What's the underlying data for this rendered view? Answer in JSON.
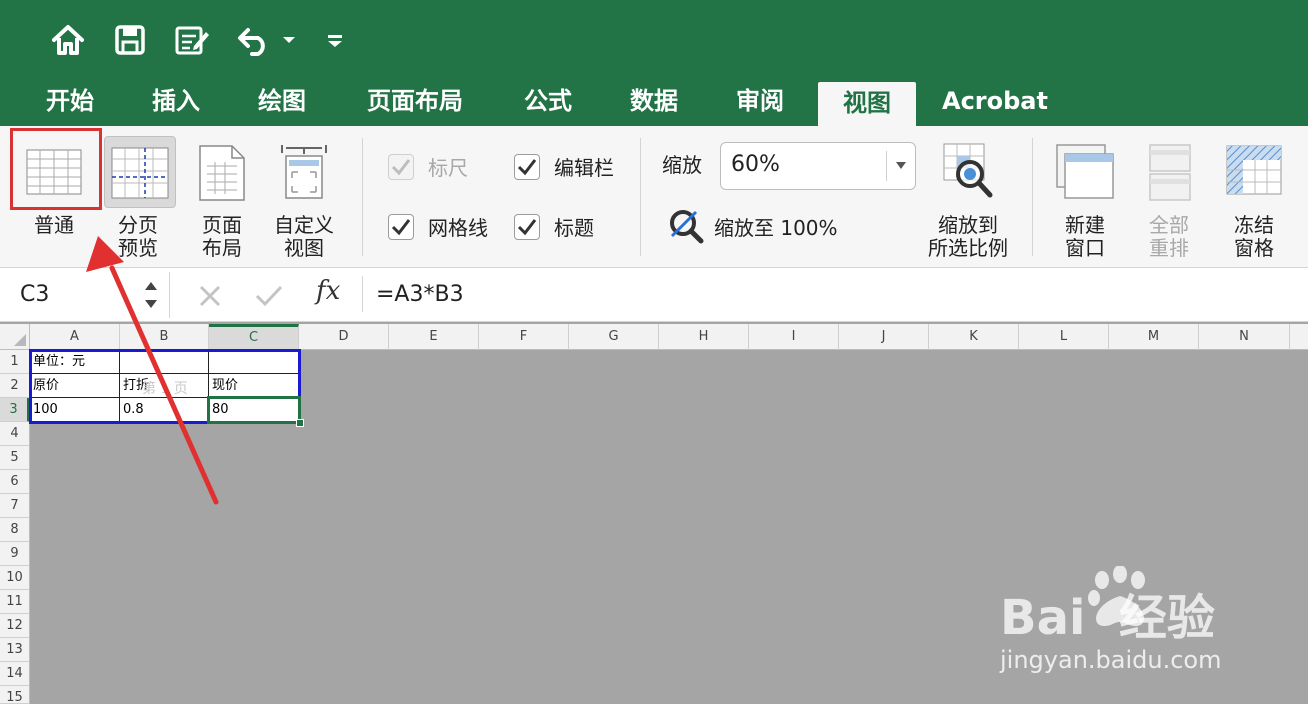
{
  "quick_access": {
    "icons": [
      "home-icon",
      "save-icon",
      "edit-document-icon",
      "undo-icon",
      "dropdown-arrow-icon",
      "customize-toolbar-icon"
    ]
  },
  "tabs": [
    {
      "label": "开始"
    },
    {
      "label": "插入"
    },
    {
      "label": "绘图"
    },
    {
      "label": "页面布局"
    },
    {
      "label": "公式"
    },
    {
      "label": "数据"
    },
    {
      "label": "审阅"
    },
    {
      "label": "视图",
      "active": true
    },
    {
      "label": "Acrobat"
    }
  ],
  "ribbon": {
    "views": {
      "normal": "普通",
      "page_break": "分页\n预览",
      "page_layout": "页面\n布局",
      "custom": "自定义\n视图"
    },
    "show": {
      "ruler": "标尺",
      "formula_bar": "编辑栏",
      "gridlines": "网格线",
      "headings": "标题"
    },
    "zoom": {
      "label": "缩放",
      "value": "60%",
      "zoom_100": "缩放至 100%",
      "zoom_selection": "缩放到\n所选比例"
    },
    "window": {
      "new_window": "新建\n窗口",
      "arrange_all": "全部\n重排",
      "freeze_panes": "冻结\n窗格"
    }
  },
  "formula_bar": {
    "name_box": "C3",
    "fx": "fx",
    "formula": "=A3*B3"
  },
  "sheet": {
    "columns": [
      "A",
      "B",
      "C",
      "D",
      "E",
      "F",
      "G",
      "H",
      "I",
      "J",
      "K",
      "L",
      "M",
      "N"
    ],
    "rows": [
      "1",
      "2",
      "3",
      "4",
      "5",
      "6",
      "7",
      "8",
      "9",
      "10",
      "11",
      "12",
      "13",
      "14",
      "15"
    ],
    "selected_cell": "C3",
    "cells": {
      "A1": "单位：元",
      "A2": "原价",
      "B2": "打折",
      "C2": "现价",
      "A3": "100",
      "B3": "0.8",
      "C3": "80"
    },
    "page_watermark": "第 1 页"
  },
  "watermark": {
    "brand": "Bai  经验",
    "url": "jingyan.baidu.com"
  },
  "colors": {
    "excel_green": "#227447",
    "highlight_red": "#e03030",
    "print_area_blue": "#1a1ad0"
  }
}
